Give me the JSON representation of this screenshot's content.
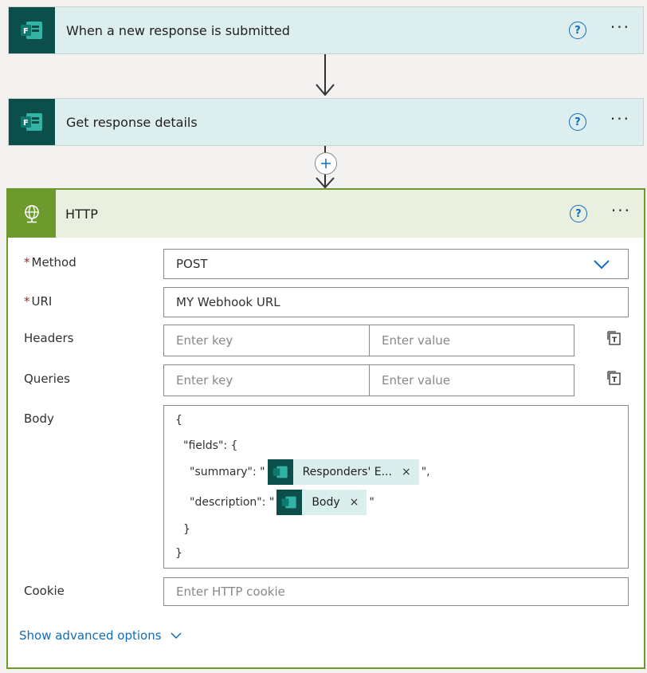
{
  "steps": [
    {
      "title": "When a new response is submitted"
    },
    {
      "title": "Get response details"
    }
  ],
  "icons": {
    "forms_app": "forms-icon",
    "http_app": "globe-icon",
    "help": "help-icon",
    "more": "more-icon",
    "remove": "close-icon",
    "add": "plus-icon",
    "chevron": "chevron-down-icon",
    "switch_mode": "text-mode-icon"
  },
  "colors": {
    "forms_tile": "#0c4f4a",
    "http_accent": "#6d9a2c",
    "link": "#0f6cbd"
  },
  "http": {
    "title": "HTTP",
    "help_glyph": "?",
    "more_glyph": "···",
    "required_mark": "*",
    "method_label": "Method",
    "method_value": "POST",
    "uri_label": "URI",
    "uri_value": "MY Webhook URL",
    "headers_label": "Headers",
    "queries_label": "Queries",
    "key_placeholder": "Enter key",
    "value_placeholder": "Enter value",
    "body_label": "Body",
    "body": {
      "open_brace": "{",
      "fields_line": "\"fields\": {",
      "summary_key": "\"summary\": \"",
      "summary_token": "Responders' E...",
      "summary_end": "\",",
      "description_key": "\"description\": \"",
      "description_token": "Body",
      "description_end": "\"",
      "inner_close": "}",
      "outer_close": "}"
    },
    "token_remove": "×",
    "cookie_label": "Cookie",
    "cookie_placeholder": "Enter HTTP cookie",
    "advanced_link": "Show advanced options"
  }
}
